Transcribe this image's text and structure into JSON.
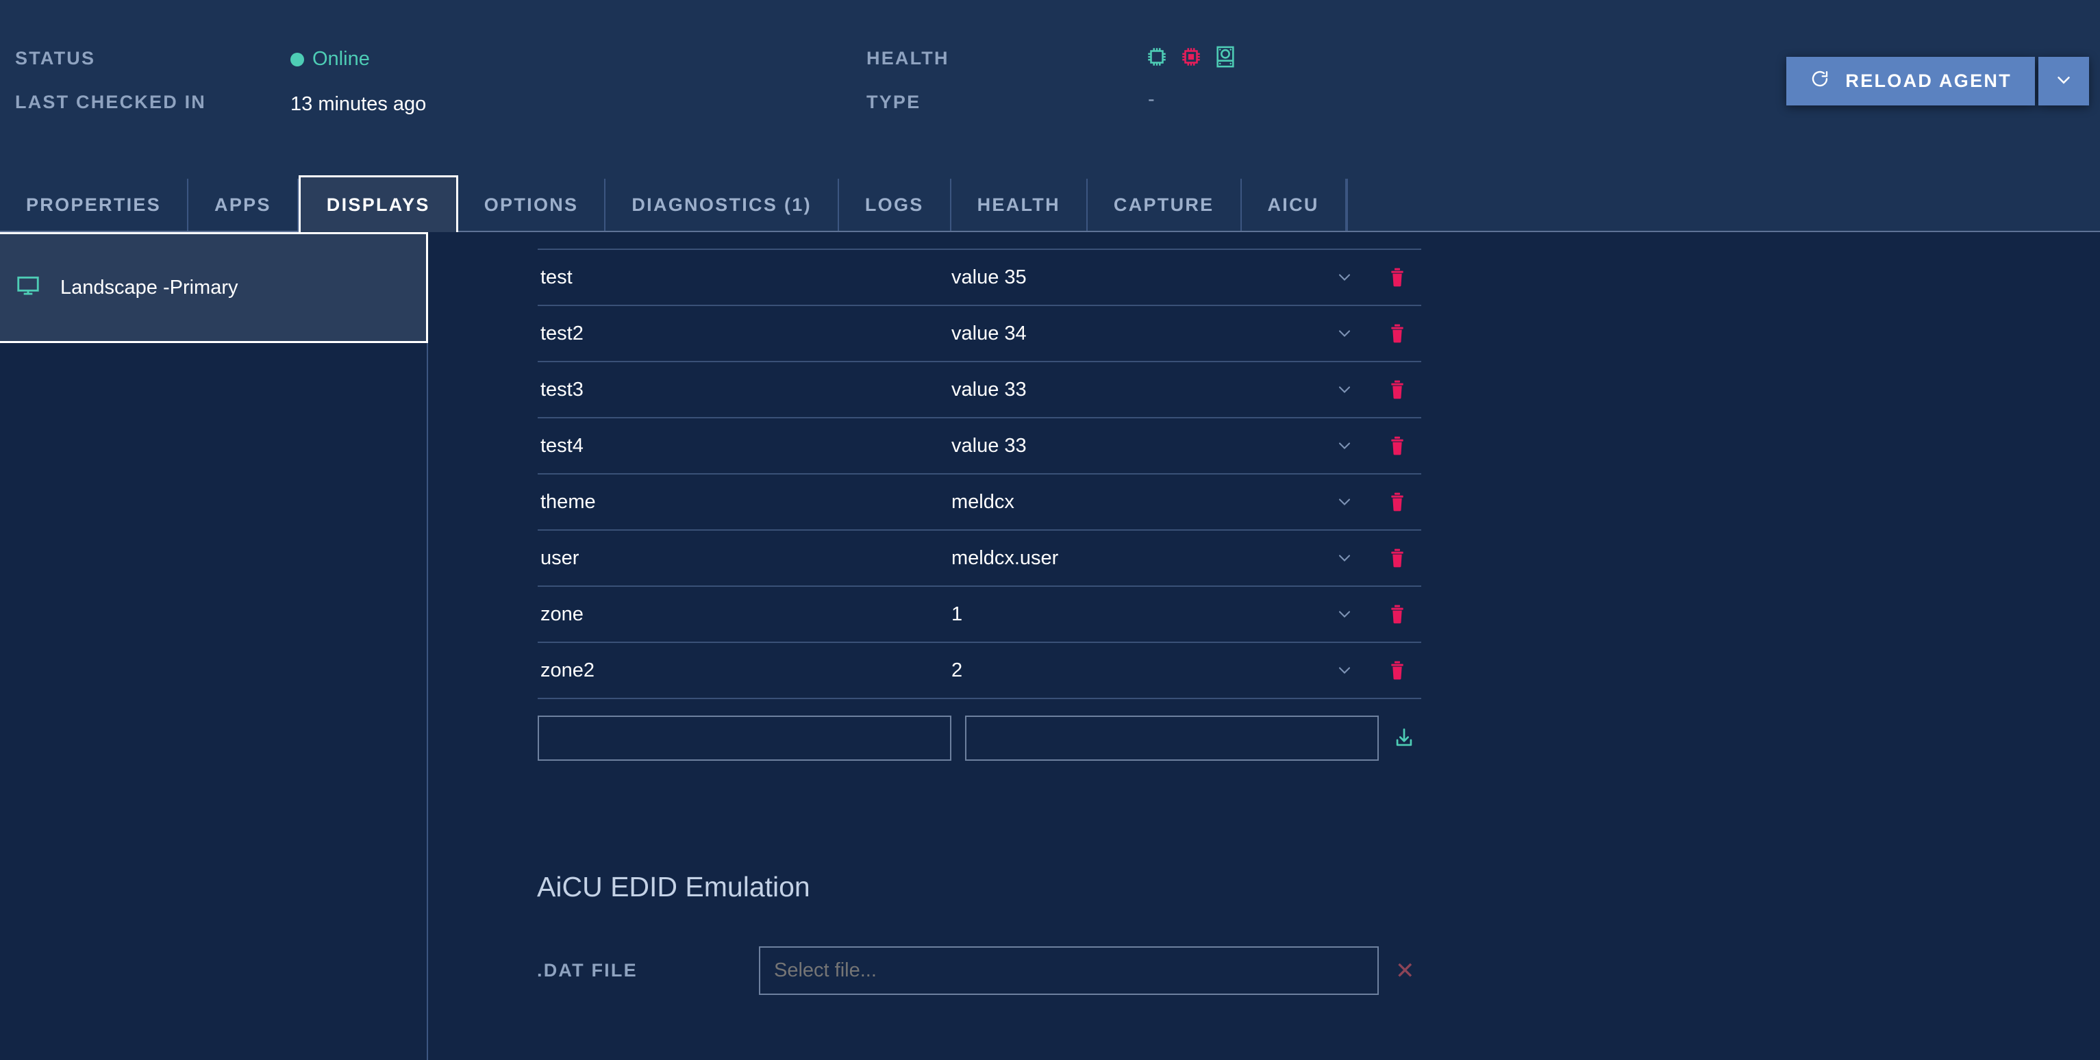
{
  "header": {
    "status_label": "STATUS",
    "status_value": "Online",
    "last_checked_label": "LAST CHECKED IN",
    "last_checked_value": "13 minutes ago",
    "health_label": "HEALTH",
    "type_label": "TYPE",
    "type_value": "-",
    "health_icons": [
      {
        "name": "cpu-icon",
        "color": "#4ecdb5"
      },
      {
        "name": "chip-icon",
        "color": "#e81d5a"
      },
      {
        "name": "disk-icon",
        "color": "#4ecdb5"
      }
    ],
    "reload_label": "RELOAD AGENT",
    "reload_icon": "refresh-icon",
    "reload_caret_icon": "chevron-down-icon",
    "accent_button": "#5b82c0",
    "online_color": "#4ecdb5"
  },
  "tabs": [
    {
      "label": "PROPERTIES",
      "active": false
    },
    {
      "label": "APPS",
      "active": false
    },
    {
      "label": "DISPLAYS",
      "active": true
    },
    {
      "label": "OPTIONS",
      "active": false
    },
    {
      "label": "DIAGNOSTICS (1)",
      "active": false
    },
    {
      "label": "LOGS",
      "active": false
    },
    {
      "label": "HEALTH",
      "active": false
    },
    {
      "label": "CAPTURE",
      "active": false
    },
    {
      "label": "AICU",
      "active": false
    }
  ],
  "sidebar": {
    "items": [
      {
        "label": "Landscape -Primary",
        "icon": "monitor-icon",
        "selected": true
      }
    ]
  },
  "main": {
    "rows": [
      {
        "key": "test",
        "value": "value 35"
      },
      {
        "key": "test2",
        "value": "value 34"
      },
      {
        "key": "test3",
        "value": "value 33"
      },
      {
        "key": "test4",
        "value": "value 33"
      },
      {
        "key": "theme",
        "value": "meldcx"
      },
      {
        "key": "user",
        "value": "meldcx.user"
      },
      {
        "key": "zone",
        "value": "1"
      },
      {
        "key": "zone2",
        "value": "2"
      }
    ],
    "new_row": {
      "key_value": "",
      "key_placeholder": "",
      "value_value": "",
      "value_placeholder": "",
      "save_icon": "download-icon"
    },
    "row_icons": {
      "expand": "chevron-down-icon",
      "delete": "trash-icon"
    },
    "delete_color": "#e8185c",
    "edid": {
      "title": "AiCU EDID Emulation",
      "file_label": ".DAT FILE",
      "file_value": "",
      "file_placeholder": "Select file...",
      "clear_icon": "close-icon",
      "clear_glyph": "✕"
    }
  }
}
